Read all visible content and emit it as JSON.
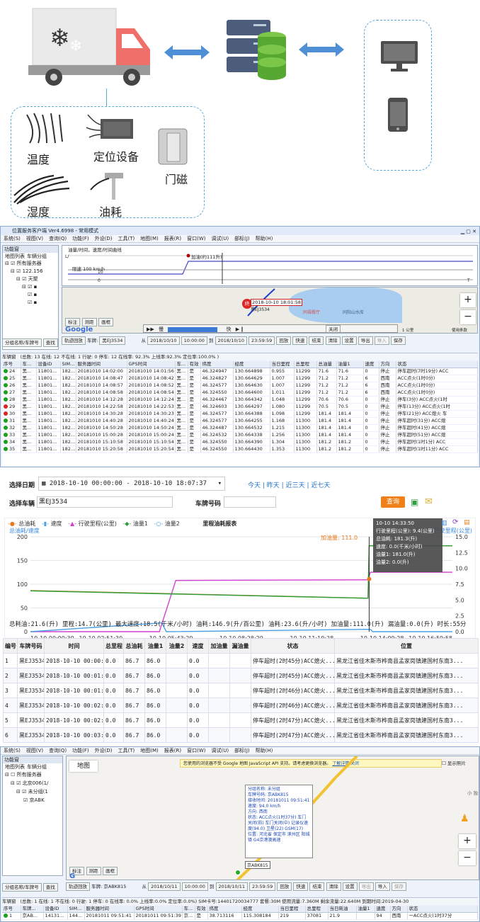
{
  "diagram": {
    "sensors": [
      {
        "label": "温度"
      },
      {
        "label": "定位设备"
      },
      {
        "label": "门磁"
      },
      {
        "label": "湿度"
      },
      {
        "label": "油耗"
      }
    ]
  },
  "app1": {
    "title": "位置服务客户端 Ver4.6998 - 常用模式",
    "menu": [
      "系统(S)",
      "视图(V)",
      "查询(Q)",
      "功能(F)",
      "外设(D)",
      "工具(T)",
      "地图(M)",
      "报表(R)",
      "窗口(W)",
      "调试(U)",
      "部标(J)",
      "帮助(H)"
    ],
    "sidebar": {
      "title": "功能窗",
      "tab1": "地图列表",
      "tab2": "车辆分组",
      "root": "所有服务器",
      "ip": "122.156",
      "node": "天聚",
      "search_label": "分组名称/车牌号",
      "search_button": "查找"
    },
    "graph": {
      "title": "油量/时间，速度/时间曲线",
      "label_refuel": "加油(约111升)",
      "label_threshold": "限速 100 km/h",
      "scale_top": "L/",
      "scale_10": "10",
      "scale_0": "0",
      "scale_T": "T"
    },
    "map": {
      "popup": "2018-10-10 18:01:58",
      "plate": "黑EJ3534",
      "poi1": "同福餐厅",
      "poi2": "同阳山水库",
      "scale": "1 公里",
      "terms": "使用条款",
      "zoom_in": "+",
      "zoom_out": "−"
    },
    "playback": {
      "slow": "慢",
      "fast": "快",
      "close": "关闭"
    },
    "map_buttons": [
      "标注",
      "测距",
      "画框"
    ],
    "google": "Google",
    "toolbar": {
      "track": "轨迹回放",
      "vehicle_label": "车牌:",
      "vehicle": "黑EJ3534",
      "from": "从",
      "to": "到",
      "date_from": "2018/10/10",
      "time_from": "10:00:00",
      "date_to": "2018/10/10",
      "time_to": "23:59:59",
      "buttons": [
        "回放",
        "快速",
        "结束",
        "清除",
        "设置"
      ],
      "export": "导出",
      "import": "导入",
      "save": "保存"
    },
    "status": {
      "panel": "车辆窗",
      "text": "(总数: 13 在线: 12 不在线: 1 行驶: 0 停车: 12 在线率: 92.3% 上线率:92.3% 定位率:100.0% )"
    },
    "columns": [
      "序号",
      "车...",
      "设备ID",
      "SIM...",
      "服务器时间",
      "GPS时间",
      "车...",
      "有效",
      "纬度",
      "经度",
      "当日里程",
      "总里程",
      "总油量",
      "油量1",
      "速度",
      "方向",
      "状态"
    ],
    "rows": [
      [
        "24",
        "黑...",
        "11801...",
        "182...",
        "20181010 14:02:00",
        "20181010 14:01:56",
        "黑...",
        "是",
        "46.324947",
        "130.664898",
        "0.955",
        "11299",
        "71.6",
        "71.6",
        "0",
        "停止",
        "停车超时(7时19分) ACC"
      ],
      [
        "25",
        "黑...",
        "11801...",
        "182...",
        "20181010 14:08:47",
        "20181010 14:08:42",
        "黑...",
        "是",
        "46.324827",
        "130.664629",
        "1.007",
        "11299",
        "71.2",
        "71.2",
        "6",
        "西南",
        "ACC点火(1时0分)"
      ],
      [
        "26",
        "黑...",
        "11801...",
        "182...",
        "20181010 14:08:57",
        "20181010 14:08:52",
        "黑...",
        "是",
        "46.324577",
        "130.664630",
        "1.007",
        "11299",
        "71.2",
        "71.2",
        "6",
        "西南",
        "ACC点火(1时0分)"
      ],
      [
        "27",
        "黑...",
        "11801...",
        "182...",
        "20181010 14:08:58",
        "20181010 14:08:54",
        "黑...",
        "是",
        "46.324550",
        "130.664600",
        "1.011",
        "11299",
        "71.2",
        "71.2",
        "6",
        "西南",
        "ACC点火(1时0分)"
      ],
      [
        "28",
        "黑...",
        "11801...",
        "182...",
        "20181010 14:12:28",
        "20181010 14:12:24",
        "黑...",
        "是",
        "46.324467",
        "130.664342",
        "1.048",
        "11299",
        "70.6",
        "70.6",
        "0",
        "停止",
        "停车(3分) ACC点火(1时"
      ],
      [
        "29",
        "黑...",
        "11801...",
        "182...",
        "20181010 14:22:58",
        "20181010 14:22:53",
        "黑...",
        "是",
        "46.324603",
        "130.664297",
        "1.080",
        "11299",
        "70.5",
        "70.5",
        "0",
        "停止",
        "停车(13分) ACC点火(1时"
      ],
      [
        "30",
        "黑...",
        "11801...",
        "182...",
        "20181010 14:30:28",
        "20181010 14:30:23",
        "黑...",
        "是",
        "46.324577",
        "130.664388",
        "1.098",
        "11299",
        "181.4",
        "181.4",
        "0",
        "停止",
        "停车(21分) ACC熄火 车"
      ],
      [
        "31",
        "黑...",
        "11801...",
        "182...",
        "20181010 14:40:28",
        "20181010 14:40:24",
        "黑...",
        "是",
        "46.324577",
        "130.664255",
        "1.168",
        "11300",
        "181.4",
        "181.4",
        "0",
        "停止",
        "停车超时(31分) ACC熄"
      ],
      [
        "32",
        "黑...",
        "11801...",
        "182...",
        "20181010 14:50:28",
        "20181010 14:50:24",
        "黑...",
        "是",
        "46.324487",
        "130.664532",
        "1.215",
        "11300",
        "181.4",
        "181.4",
        "0",
        "停止",
        "停车超时(41分) ACC熄"
      ],
      [
        "33",
        "黑...",
        "11801...",
        "182...",
        "20181010 15:00:28",
        "20181010 15:00:24",
        "黑...",
        "是",
        "46.324532",
        "130.664338",
        "1.256",
        "11300",
        "181.4",
        "181.4",
        "0",
        "停止",
        "停车超时(51分) ACC熄"
      ],
      [
        "34",
        "黑...",
        "11801...",
        "182...",
        "20181010 15:10:58",
        "20181010 15:10:54",
        "黑...",
        "是",
        "46.324550",
        "130.664390",
        "1.304",
        "11300",
        "181.2",
        "181.2",
        "0",
        "停止",
        "停车超时(1时1分) ACC"
      ],
      [
        "35",
        "黑...",
        "11801...",
        "182...",
        "20181010 15:20:58",
        "20181010 15:20:54",
        "黑...",
        "是",
        "46.324550",
        "130.664430",
        "1.353",
        "11300",
        "181.2",
        "181.2",
        "0",
        "停止",
        "停车超时(1时11分) ACC"
      ]
    ]
  },
  "web": {
    "date_label": "选择日期",
    "date_value": "2018-10-10 00:00:00 - 2018-10-10 18:07:37",
    "quick": [
      "今天",
      "昨天",
      "近三天",
      "近七天"
    ],
    "vehicle_label": "选择车辆",
    "vehicle_value": "黑EJ3534",
    "plate_label": "车牌号码",
    "query_button": "查询",
    "chart_title": "里程油耗报表",
    "legend": [
      "总油耗",
      "速度",
      "行驶里程(公里)",
      "油量1",
      "油量2"
    ],
    "chart_ylabel": "总油耗/速度",
    "chart_ylabel_right": "行驶里程(公里)",
    "tooltip": {
      "time": "10-10 14:33:50",
      "l1": "行驶里程(公里): 9.4(公里)",
      "l2": "总油耗: 181.3(升)",
      "l3": "速度: 0.0(千米/小时)",
      "l4": "油量1: 181.0(升)",
      "l5": "油量2: 0.0(升)"
    },
    "annotation": "加油量: 111.0",
    "summary": "总耗油:21.6(升) 里程:14.7(公里) 最大速度:18.5(千米/小时) 油耗:146.9(升/百公里) 油耗:23.6(升/小时) 加油量:111.0(升) 漏油量:0.0(升) 时长:55分",
    "columns": [
      "编号",
      "车牌号码",
      "时间",
      "总里程",
      "总油耗",
      "油量1",
      "油量2",
      "速度",
      "加油量",
      "漏油量",
      "状态",
      "位置"
    ],
    "rows": [
      [
        "1",
        "黑EJ3534",
        "2018-10-10 00:00:30",
        "0.0",
        "86.7",
        "86.0",
        "",
        "0.0",
        "",
        "",
        "停车超时(2时45分)ACC熄火...",
        "黑龙江省佳木斯市桦南县孟家岗镇建国村东南3..."
      ],
      [
        "2",
        "黑EJ3534",
        "2018-10-10 00:01:00",
        "0.0",
        "86.7",
        "86.0",
        "",
        "0.0",
        "",
        "",
        "停车超时(2时45分)ACC熄火...",
        "黑龙江省佳木斯市桦南县孟家岗镇建国村东南3..."
      ],
      [
        "3",
        "黑EJ3534",
        "2018-10-10 00:01:30",
        "0.0",
        "86.7",
        "86.0",
        "",
        "0.0",
        "",
        "",
        "停车超时(2时46分)ACC熄火...",
        "黑龙江省佳木斯市桦南县孟家岗镇建国村东南3..."
      ],
      [
        "4",
        "黑EJ3534",
        "2018-10-10 00:02:00",
        "0.0",
        "86.7",
        "86.0",
        "",
        "0.0",
        "",
        "",
        "停车超时(2时46分)ACC熄火...",
        "黑龙江省佳木斯市桦南县孟家岗镇建国村东南3..."
      ],
      [
        "5",
        "黑EJ3534",
        "2018-10-10 00:02:30",
        "0.0",
        "86.7",
        "86.0",
        "",
        "0.0",
        "",
        "",
        "停车超时(2时47分)ACC熄火...",
        "黑龙江省佳木斯市桦南县孟家岗镇建国村东南3..."
      ],
      [
        "6",
        "黑EJ3534",
        "2018-10-10 00:03:00",
        "0.0",
        "86.7",
        "86.0",
        "",
        "0.0",
        "",
        "",
        "停车超时(2时47分)ACC熄火...",
        "黑龙江省佳木斯市桦南县孟家岗镇建国村东南3..."
      ]
    ]
  },
  "chart_data": {
    "type": "line",
    "title": "里程油耗报表",
    "ylabel": "总油耗/速度",
    "ylabel_right": "行驶里程(公里)",
    "x_ticks": [
      "10-10 00:00:30",
      "10-10 02:51:30",
      "10-10 05:43:29",
      "10-10 08:28:29",
      "10-10 11:19:28",
      "10-10 14:09:28",
      "10-10 16:59:58"
    ],
    "ylim": [
      0,
      200
    ],
    "yticks": [
      0,
      50,
      100,
      150,
      200
    ],
    "ylim_right": [
      0,
      15
    ],
    "yticks_right": [
      "0.0",
      "2.5",
      "5.0",
      "7.5",
      "10.0",
      "12.5",
      "15.0"
    ],
    "series": [
      {
        "name": "总油耗",
        "color": "#e6781e",
        "x": [
          0,
          14.4,
          14.45,
          18
        ],
        "y": [
          86.7,
          70.5,
          181.3,
          181.0
        ]
      },
      {
        "name": "行驶里程(公里)",
        "color": "#d040d0",
        "x": [
          0,
          5.5,
          6.2,
          14.4,
          14.5,
          18
        ],
        "y": [
          0,
          0,
          8.1,
          8.2,
          9.4,
          9.4
        ]
      },
      {
        "name": "油量1",
        "color": "#2a9f3a",
        "x": [
          0,
          14.4,
          14.45,
          18
        ],
        "y": [
          86.0,
          70.5,
          181.0,
          181.0
        ]
      },
      {
        "name": "速度",
        "color": "#4aa0e6",
        "x": [
          0,
          5.6,
          5.8,
          14.5,
          14.6,
          18
        ],
        "y": [
          0,
          18.5,
          0,
          5,
          0,
          0
        ]
      }
    ]
  },
  "app2": {
    "menu": [
      "系统(S)",
      "视图(V)",
      "查询(Q)",
      "功能(F)",
      "外设(D)",
      "工具(T)",
      "地图(M)",
      "报表(R)",
      "窗口(W)",
      "调试(U)",
      "部标(J)",
      "帮助(H)"
    ],
    "sidebar": {
      "title": "功能窗",
      "tab1": "地图列表",
      "tab2": "车辆分组",
      "root": "所有服务器",
      "n1": "北京006(1/",
      "n2": "未分组(1",
      "n3": "京ABK",
      "search_label": "分组名称/车牌号",
      "search_button": "查找"
    },
    "map_tab": "地图",
    "warning": "您使用的浏览器不受 Google 地图 JavaScript API 支持。请考虑更换浏览器。",
    "warning_link": "了解详情",
    "warning_close": "关闭",
    "checks": [
      "显示照片"
    ],
    "popup": [
      "分组名称: 未分组",
      "车牌号码: 京ABK815",
      "接收时间: 20181011 09:51:41",
      "速度: 94.0 km/h",
      "方向: 西南",
      "状态: ACC点火(1时37分) 车门关闭(前) 车门关闭(中) 记录仪速度(94.0) 卫星(22) GSM(17)",
      "位置: 河北省 保定市 涿州区 阳城镇 G4京港澳高速"
    ],
    "plate_tag": "京ABK815",
    "poi": "小 独",
    "toolbar": {
      "track": "轨迹回放",
      "vehicle_label": "车牌:",
      "vehicle": "京ABK815",
      "from": "从",
      "to": "到",
      "date_from": "2018/10/11",
      "time_from": "10:00:00",
      "date_to": "2018/10/11",
      "time_to": "23:59:59",
      "buttons": [
        "回放",
        "快速",
        "结束",
        "清除",
        "设置"
      ],
      "export": "导出",
      "import": "导入",
      "save": "保存"
    },
    "map_buttons": [
      "标注",
      "测距",
      "画框"
    ],
    "status": {
      "panel": "车辆窗",
      "text": "(总数: 1 在线: 1 不在线: 0 行驶: 1 停车: 0 在线率: 0.0% 上线率:0.0% 定位率:0.0%) SIM卡号:14401720034777 套餐:30M 使用流量:7.360M 剩余流量:22.640M 到期时间:2019-04-30"
    },
    "columns": [
      "序号",
      "车牌...",
      "设备ID",
      "SIM...",
      "服务器时间",
      "GPS时间",
      "车...",
      "有效",
      "纬度",
      "经度",
      "当日里程",
      "总里程",
      "当日耗油",
      "油量1",
      "速度",
      "方向",
      "状态"
    ],
    "rows": [
      [
        "1",
        "京AB...",
        "14131...",
        "144...",
        "20181011 09:51:41",
        "20181011 09:51:39",
        "京...",
        "是",
        "38.713116",
        "115.308184",
        "219",
        "37081",
        "21.9",
        "",
        "94",
        "西南",
        "一ACC点火(1时37分"
      ]
    ]
  }
}
